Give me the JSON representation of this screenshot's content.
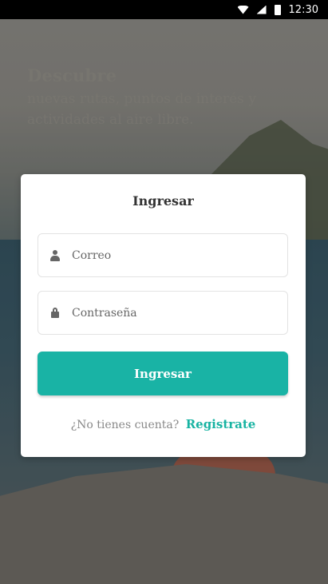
{
  "status_bar": {
    "time": "12:30"
  },
  "hero": {
    "title": "Descubre",
    "subtitle": "nuevas rutas, puntos de interés y actividades al aire libre."
  },
  "login": {
    "title": "Ingresar",
    "email_placeholder": "Correo",
    "password_placeholder": "Contraseña",
    "submit_label": "Ingresar",
    "no_account_text": "¿No tienes cuenta?",
    "signup_link": "Registrate"
  },
  "icons": {
    "email": "user-icon",
    "password": "lock-icon"
  },
  "colors": {
    "accent": "#19b3a5",
    "card": "#ffffff",
    "status_bar": "#000000"
  }
}
